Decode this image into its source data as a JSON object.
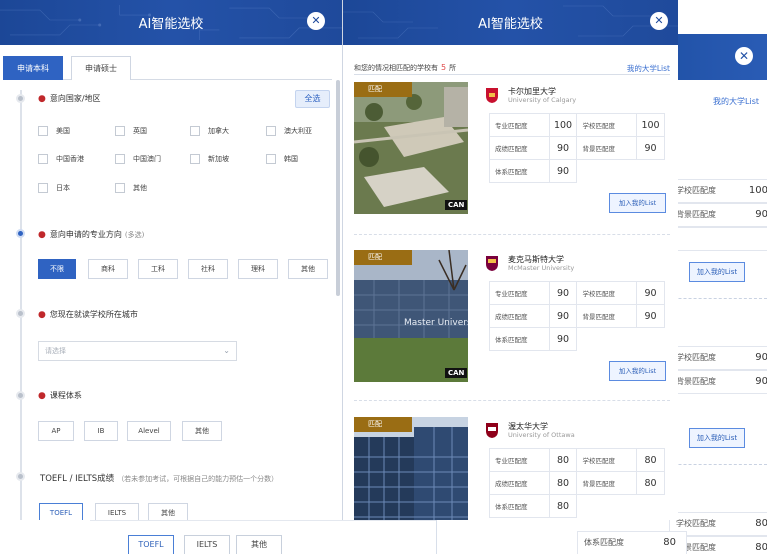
{
  "app": {
    "title": "AI智能选校"
  },
  "left": {
    "tabs": [
      {
        "label": "申请本科"
      },
      {
        "label": "申请硕士"
      }
    ],
    "country": {
      "title": "意向国家/地区",
      "select_all": "全选",
      "options": [
        "美国",
        "英国",
        "加拿大",
        "澳大利亚",
        "中国香港",
        "中国澳门",
        "新加坡",
        "韩国",
        "日本",
        "其他"
      ]
    },
    "major": {
      "title": "意向申请的专业方向",
      "note": "(多选)",
      "options": [
        "不限",
        "商科",
        "工科",
        "社科",
        "理科",
        "其他"
      ]
    },
    "city": {
      "title": "您现在就读学校所在城市",
      "placeholder": "请选择"
    },
    "curriculum": {
      "title": "课程体系",
      "options": [
        "AP",
        "IB",
        "Alevel",
        "其他"
      ]
    },
    "test": {
      "title": "TOEFL / IELTS成绩",
      "note": "（若未参加考试，可根据自己的能力预估一个分数）",
      "options": [
        "TOEFL",
        "IELTS",
        "其他"
      ]
    }
  },
  "results": {
    "summary_prefix": "和您的情况相匹配的学校有",
    "count": "5",
    "summary_suffix": "所",
    "my_list": "我的大学List",
    "match_tag": "匹配",
    "country_badge": "CAN",
    "add_button": "加入我的List",
    "labels": {
      "major": "专业匹配度",
      "school": "学校匹配度",
      "grade": "成绩匹配度",
      "background": "背景匹配度",
      "system": "体系匹配度"
    },
    "schools": [
      {
        "name_cn": "卡尔加里大学",
        "name_en": "University of Calgary",
        "major": "100",
        "school": "100",
        "grade": "90",
        "background": "90",
        "system": "90",
        "color": "#c8102e"
      },
      {
        "name_cn": "麦克马斯特大学",
        "name_en": "McMaster University",
        "major": "90",
        "school": "90",
        "grade": "90",
        "background": "90",
        "system": "90",
        "color": "#7a003c"
      },
      {
        "name_cn": "渥太华大学",
        "name_en": "University of Ottawa",
        "major": "80",
        "school": "80",
        "grade": "80",
        "background": "80",
        "system": "80",
        "color": "#8f001a"
      }
    ]
  },
  "back": {
    "my_list": "我的大学List",
    "add_button": "加入我的List",
    "rows": [
      {
        "label": "学校匹配度",
        "value": "100"
      },
      {
        "label": "背景匹配度",
        "value": "90"
      },
      {
        "label": "学校匹配度",
        "value": "90"
      },
      {
        "label": "背景匹配度",
        "value": "90"
      },
      {
        "label": "学校匹配度",
        "value": "80"
      },
      {
        "label": "背景匹配度",
        "value": "80"
      },
      {
        "label": "体系匹配度",
        "value": "80"
      }
    ]
  },
  "colors": {
    "primary": "#2f63c2",
    "header": "#1f4a9b",
    "required": "#c0282b",
    "tag": "#9a6d14"
  }
}
